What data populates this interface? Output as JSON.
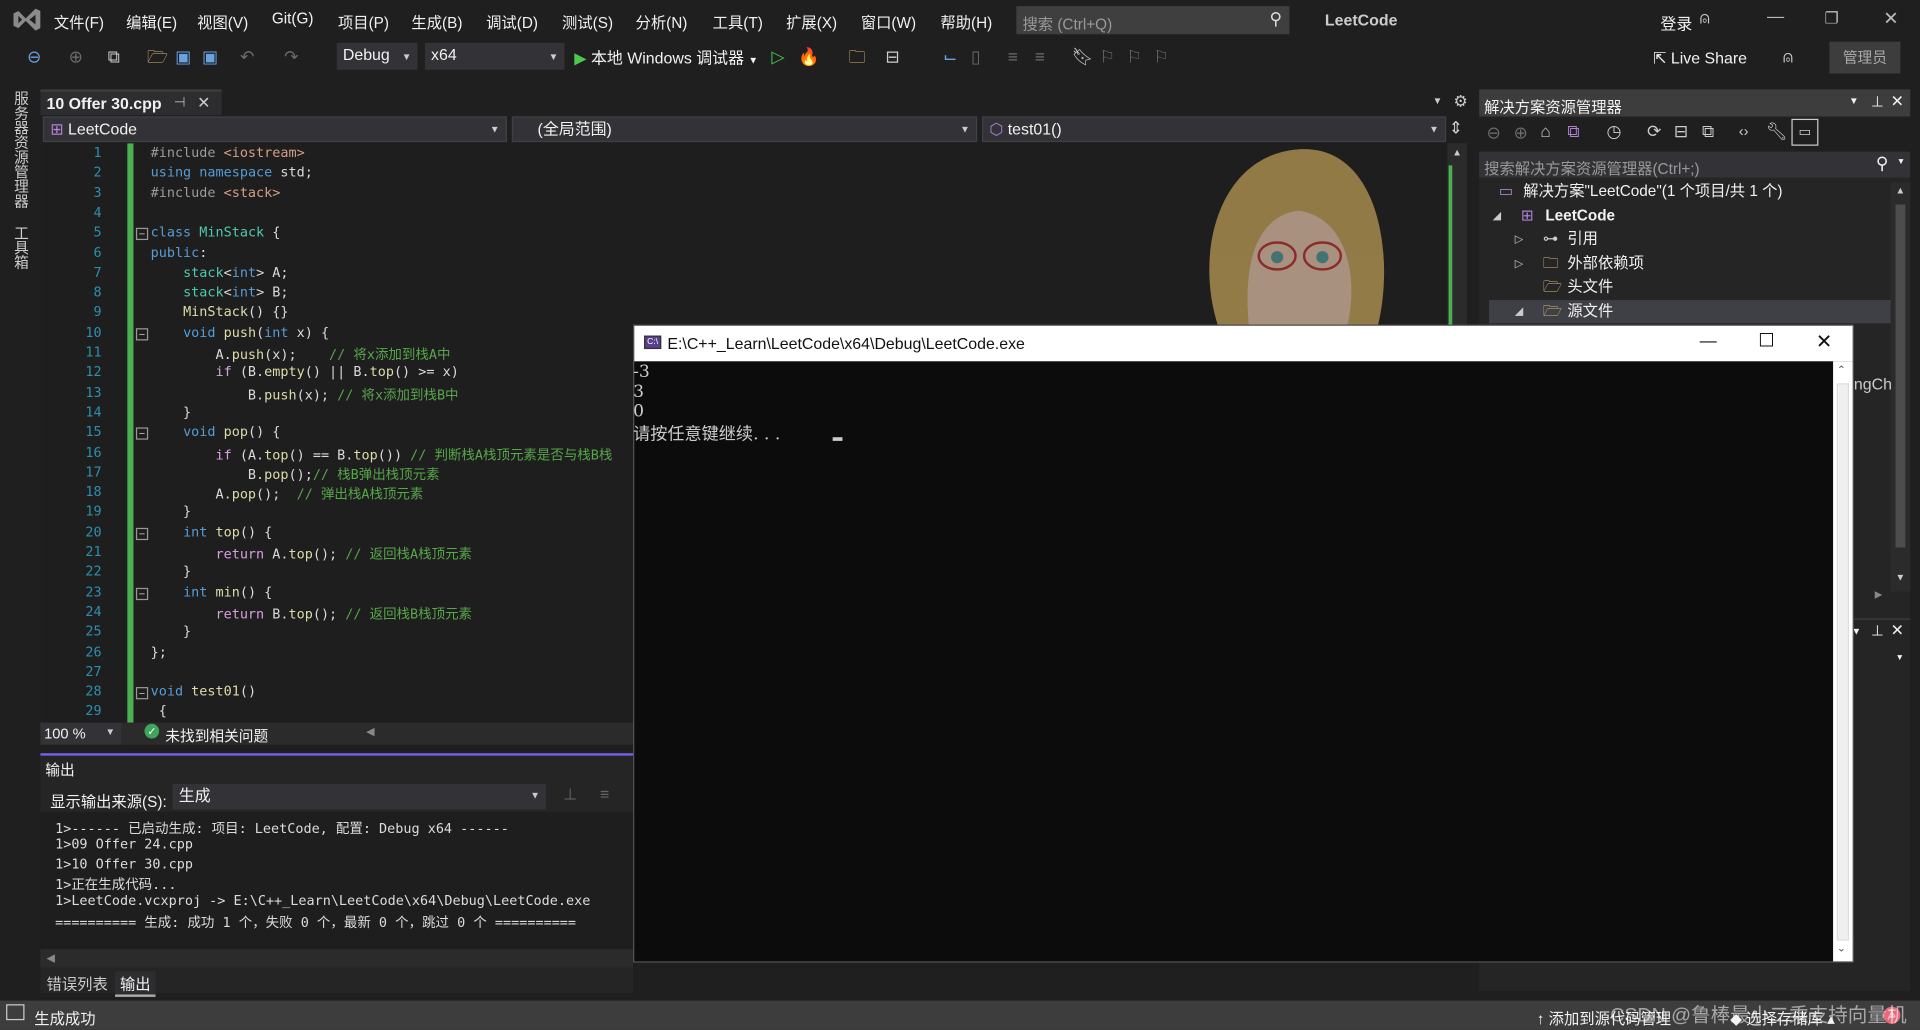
{
  "app": {
    "title": "LeetCode",
    "login": "登录",
    "admin": "管理员",
    "live_share": "Live Share"
  },
  "menu": [
    "文件(F)",
    "编辑(E)",
    "视图(V)",
    "Git(G)",
    "项目(P)",
    "生成(B)",
    "调试(D)",
    "测试(S)",
    "分析(N)",
    "工具(T)",
    "扩展(X)",
    "窗口(W)",
    "帮助(H)"
  ],
  "search": {
    "placeholder": "搜索 (Ctrl+Q)"
  },
  "toolbar": {
    "configuration": "Debug",
    "platform": "x64",
    "run_label": "本地 Windows 调试器"
  },
  "side_strip": [
    "服务器资源管理器",
    "工具箱"
  ],
  "editor": {
    "tab": "10 Offer 30.cpp",
    "nav": {
      "project": "LeetCode",
      "scope": "(全局范围)",
      "member": "test01()"
    },
    "zoom": "100 %",
    "issues": "未找到相关问题",
    "lines": [
      [
        [
          "#include",
          "p"
        ],
        [
          " ",
          "d"
        ],
        [
          "<iostream>",
          "s"
        ]
      ],
      [
        [
          "using",
          "k"
        ],
        [
          " ",
          "d"
        ],
        [
          "namespace",
          "k"
        ],
        [
          " std;",
          "d"
        ]
      ],
      [
        [
          "#include",
          "p"
        ],
        [
          " ",
          "d"
        ],
        [
          "<stack>",
          "s"
        ]
      ],
      [],
      [
        [
          "class",
          "k"
        ],
        [
          " ",
          "d"
        ],
        [
          "MinStack",
          "t"
        ],
        [
          " {",
          "d"
        ]
      ],
      [
        [
          "public",
          "k"
        ],
        [
          ":",
          "d"
        ]
      ],
      [
        [
          "    ",
          "d"
        ],
        [
          "stack",
          "t"
        ],
        [
          "<",
          "d"
        ],
        [
          "int",
          "k"
        ],
        [
          "> A;",
          "d"
        ]
      ],
      [
        [
          "    ",
          "d"
        ],
        [
          "stack",
          "t"
        ],
        [
          "<",
          "d"
        ],
        [
          "int",
          "k"
        ],
        [
          "> B;",
          "d"
        ]
      ],
      [
        [
          "    ",
          "d"
        ],
        [
          "MinStack",
          "f"
        ],
        [
          "() {}",
          "d"
        ]
      ],
      [
        [
          "    ",
          "d"
        ],
        [
          "void",
          "k"
        ],
        [
          " ",
          "d"
        ],
        [
          "push",
          "f"
        ],
        [
          "(",
          "d"
        ],
        [
          "int",
          "k"
        ],
        [
          " x) {",
          "d"
        ]
      ],
      [
        [
          "        A.",
          "d"
        ],
        [
          "push",
          "f"
        ],
        [
          "(x);    ",
          "d"
        ],
        [
          "// 将x添加到栈A中",
          "m"
        ]
      ],
      [
        [
          "        ",
          "d"
        ],
        [
          "if",
          "c"
        ],
        [
          " (B.",
          "d"
        ],
        [
          "empty",
          "f"
        ],
        [
          "() || B.",
          "d"
        ],
        [
          "top",
          "f"
        ],
        [
          "() >= x)",
          "d"
        ]
      ],
      [
        [
          "            B.",
          "d"
        ],
        [
          "push",
          "f"
        ],
        [
          "(x); ",
          "d"
        ],
        [
          "// 将x添加到栈B中",
          "m"
        ]
      ],
      [
        [
          "    }",
          "d"
        ]
      ],
      [
        [
          "    ",
          "d"
        ],
        [
          "void",
          "k"
        ],
        [
          " ",
          "d"
        ],
        [
          "pop",
          "f"
        ],
        [
          "() {",
          "d"
        ]
      ],
      [
        [
          "        ",
          "d"
        ],
        [
          "if",
          "c"
        ],
        [
          " (A.",
          "d"
        ],
        [
          "top",
          "f"
        ],
        [
          "() == B.",
          "d"
        ],
        [
          "top",
          "f"
        ],
        [
          "()) ",
          "d"
        ],
        [
          "// 判断栈A栈顶元素是否与栈B栈",
          "m"
        ]
      ],
      [
        [
          "            B.",
          "d"
        ],
        [
          "pop",
          "f"
        ],
        [
          "();",
          "d"
        ],
        [
          "// 栈B弹出栈顶元素",
          "m"
        ]
      ],
      [
        [
          "        A.",
          "d"
        ],
        [
          "pop",
          "f"
        ],
        [
          "();  ",
          "d"
        ],
        [
          "// 弹出栈A栈顶元素",
          "m"
        ]
      ],
      [
        [
          "    }",
          "d"
        ]
      ],
      [
        [
          "    ",
          "d"
        ],
        [
          "int",
          "k"
        ],
        [
          " ",
          "d"
        ],
        [
          "top",
          "f"
        ],
        [
          "() {",
          "d"
        ]
      ],
      [
        [
          "        ",
          "d"
        ],
        [
          "return",
          "c"
        ],
        [
          " A.",
          "d"
        ],
        [
          "top",
          "f"
        ],
        [
          "(); ",
          "d"
        ],
        [
          "// 返回栈A栈顶元素",
          "m"
        ]
      ],
      [
        [
          "    }",
          "d"
        ]
      ],
      [
        [
          "    ",
          "d"
        ],
        [
          "int",
          "k"
        ],
        [
          " ",
          "d"
        ],
        [
          "min",
          "f"
        ],
        [
          "() {",
          "d"
        ]
      ],
      [
        [
          "        ",
          "d"
        ],
        [
          "return",
          "c"
        ],
        [
          " B.",
          "d"
        ],
        [
          "top",
          "f"
        ],
        [
          "(); ",
          "d"
        ],
        [
          "// 返回栈B栈顶元素",
          "m"
        ]
      ],
      [
        [
          "    }",
          "d"
        ]
      ],
      [
        [
          "};",
          "d"
        ]
      ],
      [],
      [
        [
          "void",
          "k"
        ],
        [
          " ",
          "d"
        ],
        [
          "test01",
          "f"
        ],
        [
          "()",
          "d"
        ]
      ],
      [
        [
          " {",
          "d"
        ]
      ]
    ]
  },
  "output": {
    "title": "输出",
    "source_label": "显示输出来源(S):",
    "source_value": "生成",
    "lines": [
      "1>------ 已启动生成: 项目: LeetCode, 配置: Debug x64 ------",
      "1>09 Offer 24.cpp",
      "1>10 Offer 30.cpp",
      "1>正在生成代码...",
      "1>LeetCode.vcxproj -> E:\\C++_Learn\\LeetCode\\x64\\Debug\\LeetCode.exe",
      "========== 生成: 成功 1 个，失败 0 个，最新 0 个，跳过 0 个 =========="
    ],
    "tabs": [
      "错误列表",
      "输出"
    ]
  },
  "solution_explorer": {
    "title": "解决方案资源管理器",
    "search_placeholder": "搜索解决方案资源管理器(Ctrl+;)",
    "items": [
      {
        "label": "解决方案\"LeetCode\"(1 个项目/共 1 个)",
        "icon": "solution-icon"
      },
      {
        "label": "LeetCode",
        "icon": "project-icon",
        "expanded": true
      },
      {
        "label": "引用",
        "icon": "reference-icon",
        "expanded": false
      },
      {
        "label": "外部依赖项",
        "icon": "external-deps-icon",
        "expanded": false
      },
      {
        "label": "头文件",
        "icon": "filter-folder-icon"
      },
      {
        "label": "源文件",
        "icon": "filter-folder-icon",
        "expanded": true,
        "selected": true
      }
    ],
    "partial_text": "ngCh"
  },
  "console": {
    "title": "E:\\C++_Learn\\LeetCode\\x64\\Debug\\LeetCode.exe",
    "lines": [
      "-3",
      "3",
      "0",
      "请按任意键继续. . . "
    ]
  },
  "status": {
    "message": "生成成功",
    "add_source": "添加到源代码管理",
    "select_repo": "选择存储库",
    "notifications": "1",
    "watermark": "CSDN @鲁棒最小二乘支持向量机"
  },
  "colors": {
    "accent": "#68217a",
    "output_active": "#7160e8",
    "change_bar": "#4caf50"
  }
}
